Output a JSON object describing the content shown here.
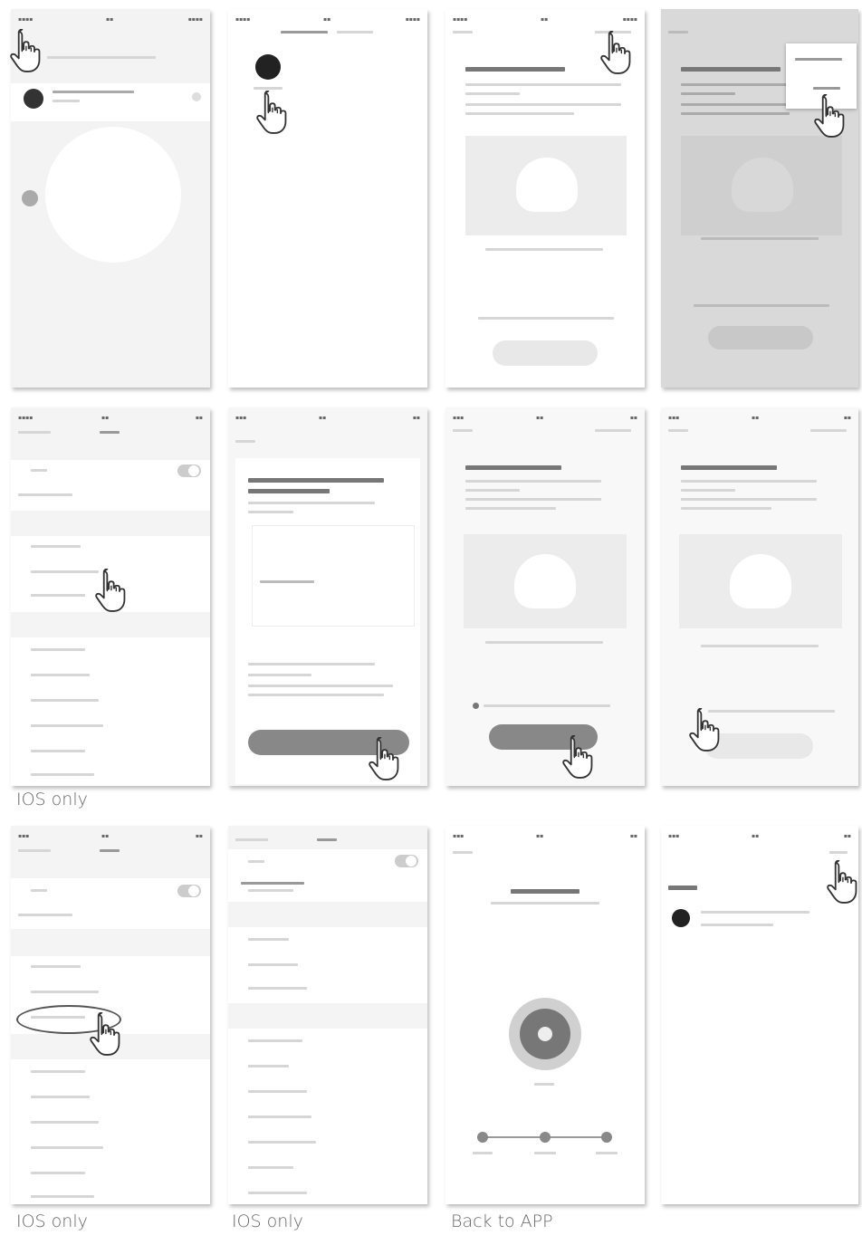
{
  "captions": {
    "ios_only_1": "IOS only",
    "ios_only_2": "IOS only",
    "ios_only_3": "IOS only",
    "back_to_app": "Back to APP"
  },
  "icons": {
    "pointer": "pointing-hand-icon",
    "wifi": "wifi-icon",
    "info": "info-icon",
    "check": "checkmark-icon",
    "toggle": "toggle-switch-icon"
  },
  "colors": {
    "button_dark": "#888888",
    "button_light": "#e8e8e8",
    "background_gray": "#f2f2f2"
  }
}
